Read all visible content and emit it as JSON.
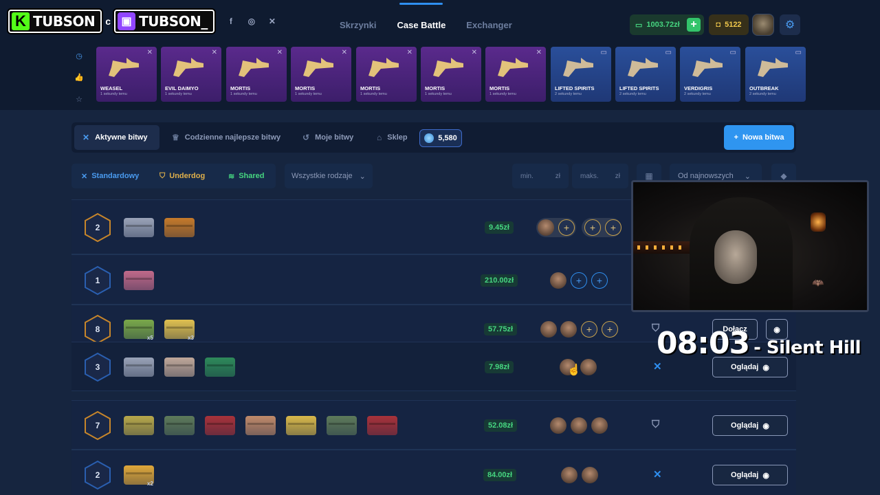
{
  "streamer": {
    "kick_name": "TUBSON",
    "separator": "c",
    "twitch_name": "TUBSON_"
  },
  "header": {
    "nav": [
      "Skrzynki",
      "Case Battle",
      "Exchanger"
    ],
    "active_nav": "Case Battle",
    "balance": "1003.72zł",
    "coins": "5122",
    "accent": "#2f95f0"
  },
  "drops": [
    {
      "name": "WEASEL",
      "sub": "1 sekundy temu",
      "color": "purple"
    },
    {
      "name": "EVIL DAIMYO",
      "sub": "1 sekundy temu",
      "color": "purple"
    },
    {
      "name": "MORTIS",
      "sub": "1 sekundy temu",
      "color": "purple"
    },
    {
      "name": "MORTIS",
      "sub": "1 sekundy temu",
      "color": "purple"
    },
    {
      "name": "MORTIS",
      "sub": "1 sekundy temu",
      "color": "purple"
    },
    {
      "name": "MORTIS",
      "sub": "1 sekundy temu",
      "color": "purple"
    },
    {
      "name": "MORTIS",
      "sub": "1 sekundy temu",
      "color": "purple"
    },
    {
      "name": "LIFTED SPIRITS",
      "sub": "2 sekundy temu",
      "color": "blue"
    },
    {
      "name": "LIFTED SPIRITS",
      "sub": "2 sekundy temu",
      "color": "blue"
    },
    {
      "name": "VERDIGRIS",
      "sub": "2 sekundy temu",
      "color": "blue"
    },
    {
      "name": "OUTBREAK",
      "sub": "2 sekundy temu",
      "color": "blue"
    }
  ],
  "tabs": {
    "active": "Aktywne bitwy",
    "daily": "Codzienne najlepsze bitwy",
    "mine": "Moje bitwy",
    "shop": "Sklep",
    "gems": "5,580",
    "new_battle": "Nowa bitwa"
  },
  "filters": {
    "standard": "Standardowy",
    "underdog": "Underdog",
    "shared": "Shared",
    "all_types": "Wszystkie rodzaje",
    "min": "min.",
    "max": "maks.",
    "currency": "zł",
    "sort": "Od najnowszych"
  },
  "battles": [
    {
      "rounds": "2",
      "price": "9.45zł",
      "ring": "gold"
    },
    {
      "rounds": "1",
      "price": "210.00zł",
      "ring": "blue"
    },
    {
      "rounds": "8",
      "price": "57.75zł",
      "ring": "gold",
      "counts": [
        "x5",
        "x3"
      ],
      "action": "Dołącz"
    },
    {
      "rounds": "3",
      "price": "7.98zł",
      "ring": "blue",
      "action": "Oglądaj"
    },
    {
      "rounds": "7",
      "price": "52.08zł",
      "ring": "gold",
      "action": "Oglądaj"
    },
    {
      "rounds": "2",
      "price": "84.00zł",
      "ring": "blue",
      "counts": [
        "x2"
      ],
      "action": "Oglądaj"
    }
  ],
  "overlay": {
    "time": "08:03",
    "song": "- Silent Hill"
  }
}
